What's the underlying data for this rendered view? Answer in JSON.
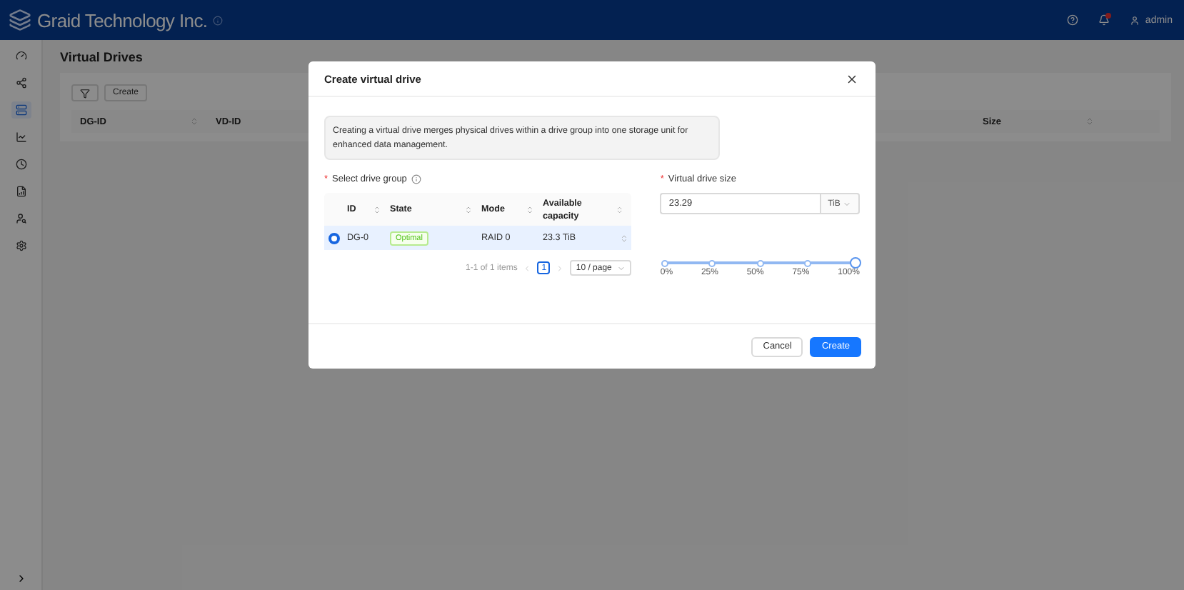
{
  "header": {
    "brand": "Graid Technology Inc.",
    "user": "admin",
    "has_notification": true
  },
  "sidebar": {
    "items": [
      {
        "kind": "dashboard",
        "selected": false
      },
      {
        "kind": "topology",
        "selected": false
      },
      {
        "kind": "drives",
        "selected": true
      },
      {
        "kind": "chart",
        "selected": false
      },
      {
        "kind": "history",
        "selected": false
      },
      {
        "kind": "report",
        "selected": false
      },
      {
        "kind": "users",
        "selected": false
      },
      {
        "kind": "settings",
        "selected": false
      }
    ]
  },
  "page": {
    "title": "Virtual Drives",
    "toolbar": {
      "button": "Create"
    },
    "columns": [
      "DG-ID",
      "VD-ID",
      "Size"
    ]
  },
  "dialog": {
    "title": "Create virtual drive",
    "info": "Creating a virtual drive merges physical drives within a drive group into one storage unit for enhanced data management.",
    "required_mark": "*",
    "group_label": "Select drive group",
    "group_table": {
      "columns": [
        "ID",
        "State",
        "Mode",
        "Available capacity"
      ],
      "rows": [
        {
          "selected": true,
          "id": "DG-0",
          "state": "Optimal",
          "mode": "RAID 0",
          "capacity": "23.3 TiB"
        }
      ]
    },
    "pagination": {
      "summary": "1-1 of 1 items",
      "page": "1",
      "page_size": "10 / page"
    },
    "size_label": "Virtual drive size",
    "size_value": "23.29",
    "size_unit": "TiB",
    "slider": {
      "level": 1,
      "marks": [
        "0%",
        "25%",
        "50%",
        "75%",
        "100%"
      ]
    },
    "buttons": {
      "cancel": "Cancel",
      "confirm": "Create"
    }
  }
}
